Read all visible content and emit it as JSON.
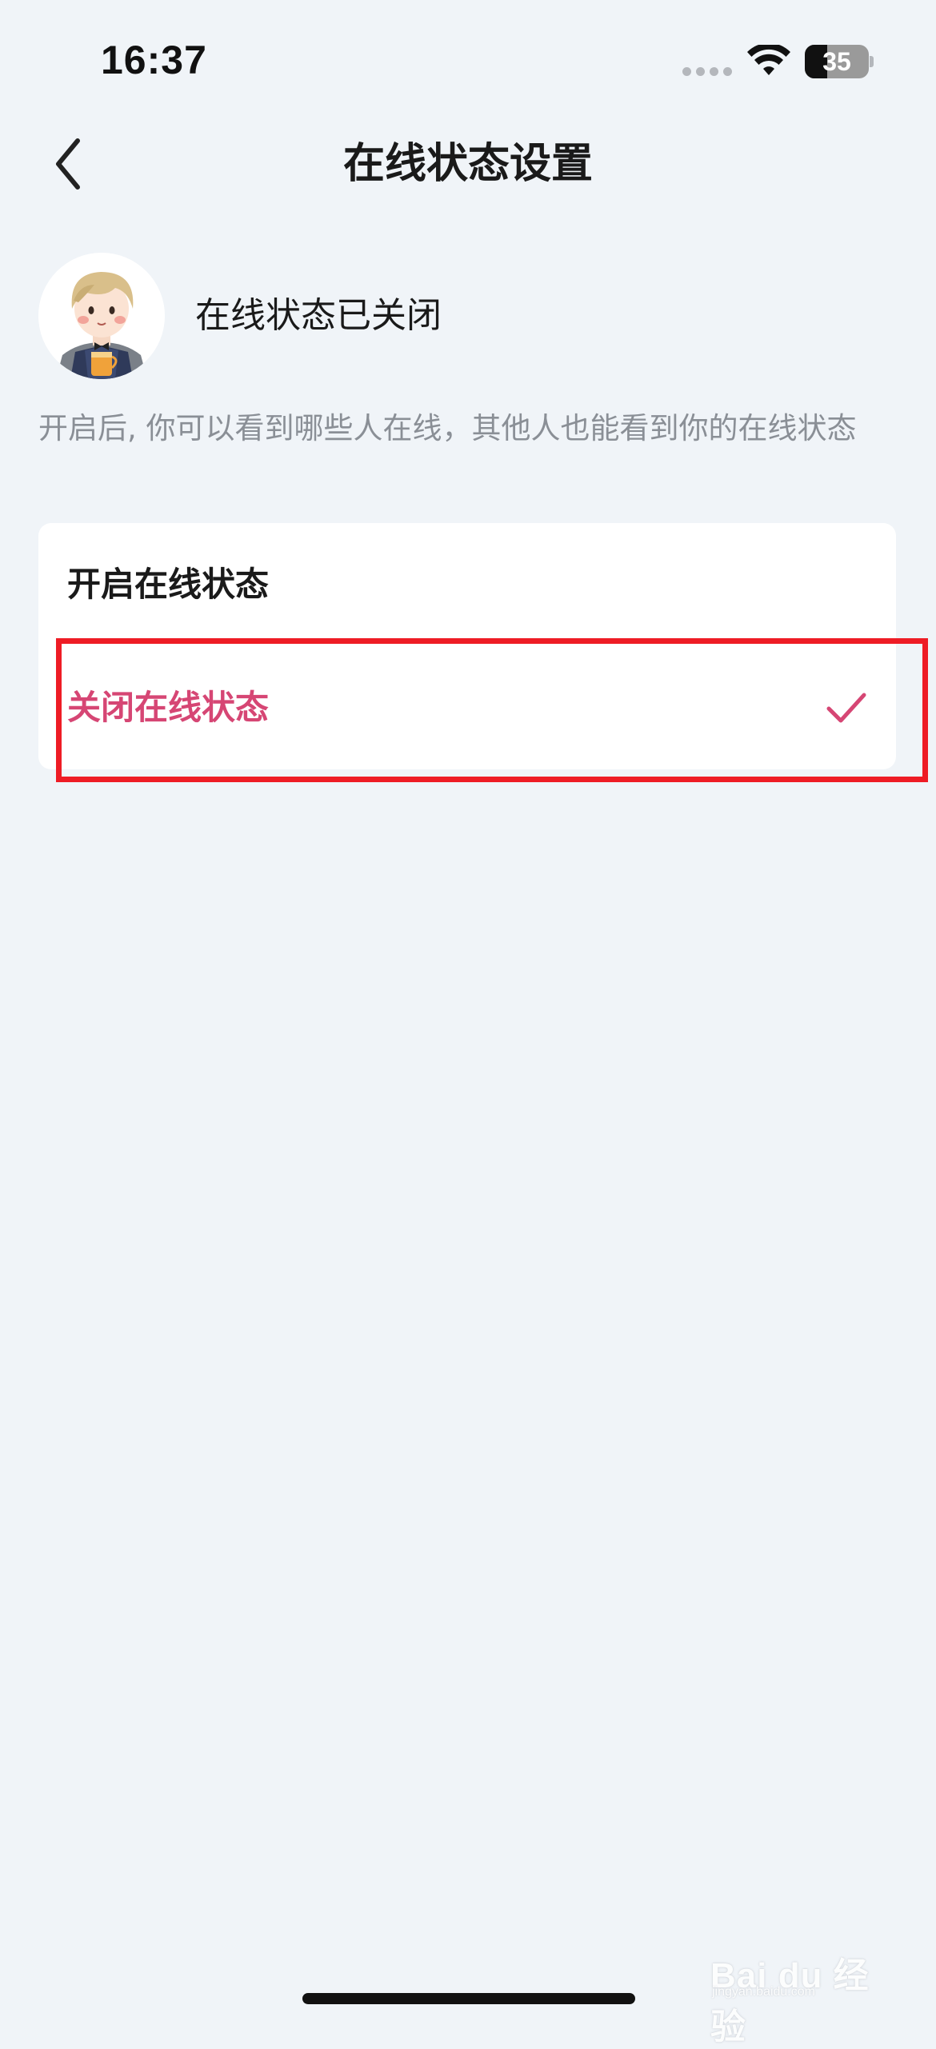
{
  "status_bar": {
    "time": "16:37",
    "battery_level": "35",
    "battery_fraction": 0.35,
    "icons": [
      "signal-dots-icon",
      "wifi-icon",
      "battery-icon"
    ]
  },
  "nav": {
    "back_icon": "chevron-left-icon",
    "title": "在线状态设置"
  },
  "profile": {
    "status_text": "在线状态已关闭"
  },
  "description": "开启后, 你可以看到哪些人在线，其他人也能看到你的在线状态",
  "options": [
    {
      "label": "开启在线状态",
      "selected": false
    },
    {
      "label": "关闭在线状态",
      "selected": true
    }
  ],
  "colors": {
    "accent": "#d64674",
    "highlight_box": "#ee1c25",
    "background": "#f0f4f8"
  },
  "watermark": {
    "text": "Bai du 经验",
    "sub": "jingyan.baidu.com"
  }
}
